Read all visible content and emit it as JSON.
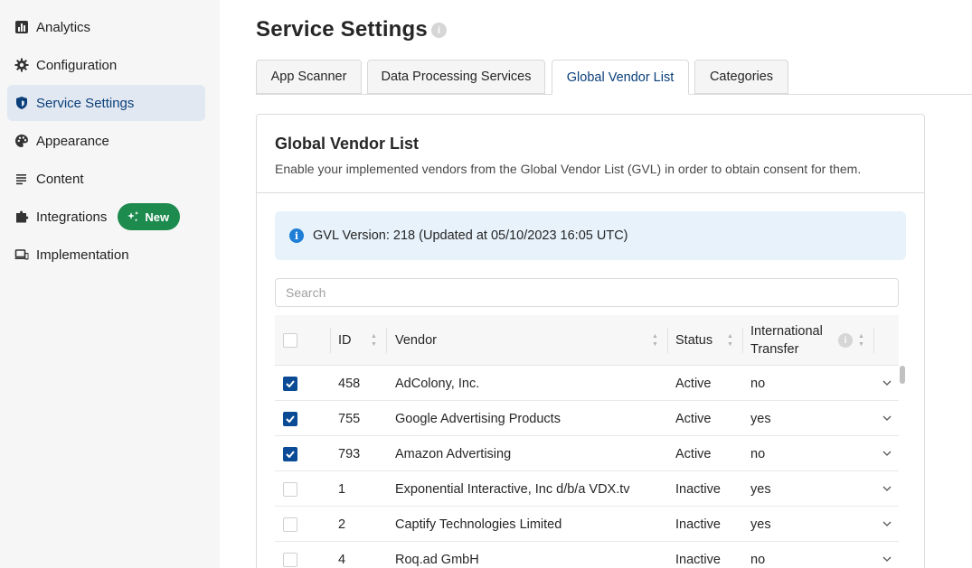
{
  "sidebar": {
    "items": [
      {
        "label": "Analytics",
        "icon": "analytics-icon"
      },
      {
        "label": "Configuration",
        "icon": "gear-icon"
      },
      {
        "label": "Service Settings",
        "icon": "shield-icon",
        "active": true
      },
      {
        "label": "Appearance",
        "icon": "palette-icon"
      },
      {
        "label": "Content",
        "icon": "lines-icon"
      },
      {
        "label": "Integrations",
        "icon": "puzzle-icon",
        "badge": "New"
      },
      {
        "label": "Implementation",
        "icon": "devices-icon"
      }
    ]
  },
  "header": {
    "title": "Service Settings",
    "info_glyph": "i"
  },
  "tabs": [
    {
      "label": "App Scanner"
    },
    {
      "label": "Data Processing Services"
    },
    {
      "label": "Global Vendor List",
      "active": true
    },
    {
      "label": "Categories"
    }
  ],
  "panel": {
    "title": "Global Vendor List",
    "description": "Enable your implemented vendors from the Global Vendor List (GVL) in order to obtain consent for them."
  },
  "alert": {
    "glyph": "i",
    "text": "GVL Version: 218 (Updated at 05/10/2023 16:05 UTC)"
  },
  "search": {
    "placeholder": "Search",
    "value": ""
  },
  "table": {
    "headers": {
      "id": "ID",
      "vendor": "Vendor",
      "status": "Status",
      "transfer_line1": "International",
      "transfer_line2": "Transfer"
    },
    "rows": [
      {
        "checked": true,
        "id": "458",
        "vendor": "AdColony, Inc.",
        "status": "Active",
        "transfer": "no"
      },
      {
        "checked": true,
        "id": "755",
        "vendor": "Google Advertising Products",
        "status": "Active",
        "transfer": "yes"
      },
      {
        "checked": true,
        "id": "793",
        "vendor": "Amazon Advertising",
        "status": "Active",
        "transfer": "no"
      },
      {
        "checked": false,
        "id": "1",
        "vendor": "Exponential Interactive, Inc d/b/a VDX.tv",
        "status": "Inactive",
        "transfer": "yes"
      },
      {
        "checked": false,
        "id": "2",
        "vendor": "Captify Technologies Limited",
        "status": "Inactive",
        "transfer": "yes"
      },
      {
        "checked": false,
        "id": "4",
        "vendor": "Roq.ad GmbH",
        "status": "Inactive",
        "transfer": "no"
      }
    ]
  },
  "colors": {
    "accent": "#0b4a95",
    "active_nav_bg": "#e1e8f1",
    "badge_green": "#1d8a4e",
    "alert_bg": "#e7f2fb"
  }
}
